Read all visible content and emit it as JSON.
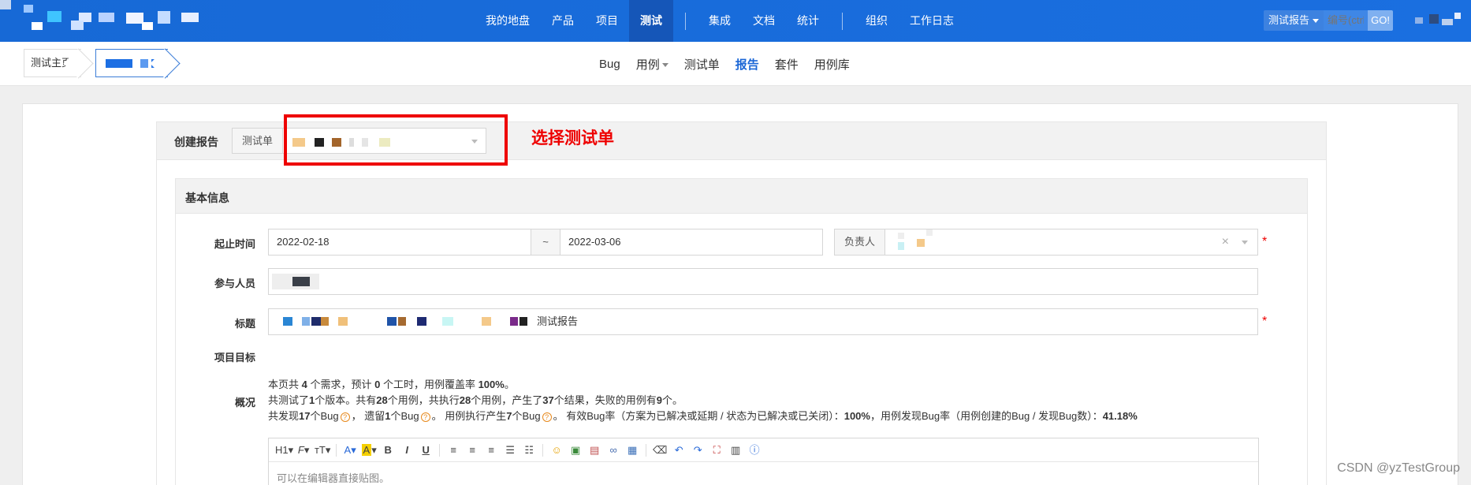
{
  "topbar": {
    "nav": [
      {
        "label": "我的地盘",
        "active": false
      },
      {
        "label": "产品",
        "active": false
      },
      {
        "label": "项目",
        "active": false
      },
      {
        "label": "测试",
        "active": true
      },
      {
        "label": "集成",
        "active": false
      },
      {
        "label": "文档",
        "active": false
      },
      {
        "label": "统计",
        "active": false
      },
      {
        "label": "组织",
        "active": false
      },
      {
        "label": "工作日志",
        "active": false
      }
    ],
    "search": {
      "type_label": "测试报告",
      "placeholder": "编号(ctrl",
      "go_label": "GO!"
    }
  },
  "subnav": {
    "breadcrumb_home": "测试主页",
    "tabs": [
      "Bug",
      "用例",
      "测试单",
      "报告",
      "套件",
      "用例库"
    ],
    "active_tab": "报告"
  },
  "form": {
    "create_label": "创建报告",
    "testtask_addon": "测试单",
    "annotation": "选择测试单",
    "section_title": "基本信息",
    "date_label": "起止时间",
    "date_begin": "2022-02-18",
    "date_sep": "~",
    "date_end": "2022-03-06",
    "owner_addon": "负责人",
    "members_label": "参与人员",
    "title_label": "标题",
    "title_suffix": "测试报告",
    "goal_label": "项目目标",
    "summary_label": "概况",
    "summary": {
      "line1_a": "本页共 ",
      "line1_b": "4",
      "line1_c": " 个需求，预计 ",
      "line1_d": "0",
      "line1_e": " 个工时，用例覆盖率 ",
      "line1_f": "100%",
      "line1_g": "。",
      "line2_a": "共测试了",
      "line2_b": "1",
      "line2_c": "个版本。共有",
      "line2_d": "28",
      "line2_e": "个用例，共执行",
      "line2_f": "28",
      "line2_g": "个用例，产生了",
      "line2_h": "37",
      "line2_i": "个结果，失败的用例有",
      "line2_j": "9",
      "line2_k": "个。",
      "line3_a": "共发现",
      "line3_b": "17",
      "line3_c": "个Bug",
      "line3_d": "，  遗留",
      "line3_e": "1",
      "line3_f": "个Bug",
      "line3_g": "。  用例执行产生",
      "line3_h": "7",
      "line3_i": "个Bug",
      "line3_j": "。  有效Bug率（方案为已解决或延期 / 状态为已解决或已关闭）：",
      "line3_k": "100%",
      "line3_l": "，用例发现Bug率（用例创建的Bug / 发现Bug数）：",
      "line3_m": "41.18%"
    },
    "editor_placeholder": "可以在编辑器直接贴图。"
  },
  "watermark": "CSDN @yzTestGroup",
  "colors": {
    "topbar": "#1769d6",
    "accent": "#1a66d6",
    "annotation": "#ee0000"
  }
}
